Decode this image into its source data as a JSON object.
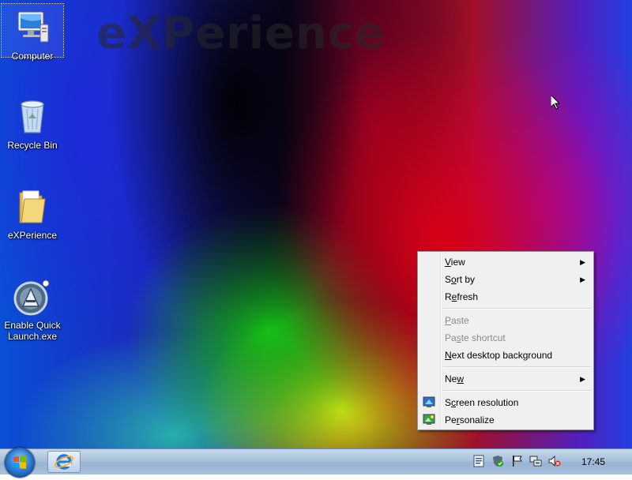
{
  "desktop": {
    "wallpaper_text": "eXPerience",
    "icons": [
      {
        "label": "Computer",
        "icon": "computer-icon",
        "selected": true
      },
      {
        "label": "Recycle Bin",
        "icon": "recycle-bin-icon"
      },
      {
        "label": "eXPerience",
        "icon": "folder-icon"
      },
      {
        "label": "Enable Quick Launch.exe",
        "icon": "quick-launch-app-icon"
      }
    ]
  },
  "context_menu": {
    "items": [
      {
        "label": "View",
        "accesskey": "V",
        "submenu": true
      },
      {
        "label": "Sort by",
        "accesskey": "o",
        "submenu": true
      },
      {
        "label": "Refresh",
        "accesskey": "e"
      },
      {
        "separator": true
      },
      {
        "label": "Paste",
        "accesskey": "P",
        "disabled": true
      },
      {
        "label": "Paste shortcut",
        "accesskey": "s",
        "disabled": true
      },
      {
        "label": "Next desktop background",
        "accesskey": "N"
      },
      {
        "separator": true
      },
      {
        "label": "New",
        "accesskey": "w",
        "submenu": true
      },
      {
        "separator": true
      },
      {
        "label": "Screen resolution",
        "accesskey": "c",
        "icon": "screen-resolution-icon"
      },
      {
        "label": "Personalize",
        "accesskey": "r",
        "icon": "personalize-icon"
      }
    ]
  },
  "taskbar": {
    "start_icon": "windows-start-orb-icon",
    "pinned": [
      {
        "icon": "internet-explorer-icon"
      }
    ],
    "tray_icons": [
      "document-icon",
      "security-shield-icon",
      "action-center-flag-icon",
      "network-icon",
      "volume-muted-icon"
    ],
    "clock": "17:45"
  },
  "colors": {
    "menu_bg": "#f0f0f0",
    "menu_border": "#979797",
    "taskbar": "#a9c1dc"
  }
}
